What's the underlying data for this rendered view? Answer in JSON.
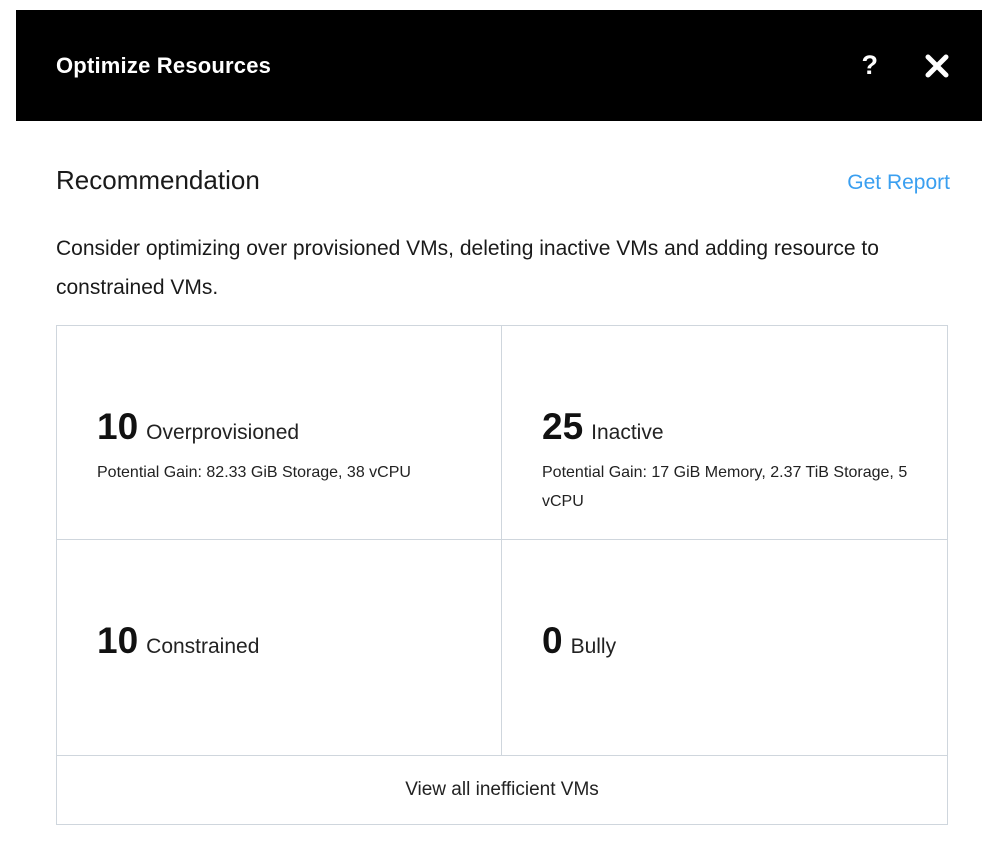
{
  "header": {
    "title": "Optimize Resources",
    "help_glyph": "?",
    "icons": {
      "help": "question-mark-icon",
      "close": "close-icon"
    }
  },
  "recommendation": {
    "title": "Recommendation",
    "report_link": "Get Report",
    "description": "Consider optimizing over provisioned VMs, deleting inactive VMs and adding resource to constrained VMs."
  },
  "stats": [
    {
      "count": "10",
      "label": "Overprovisioned",
      "gain": "Potential Gain: 82.33 GiB Storage, 38 vCPU"
    },
    {
      "count": "25",
      "label": "Inactive",
      "gain": "Potential Gain: 17 GiB Memory, 2.37 TiB Storage, 5 vCPU"
    },
    {
      "count": "10",
      "label": "Constrained",
      "gain": ""
    },
    {
      "count": "0",
      "label": "Bully",
      "gain": ""
    }
  ],
  "footer": {
    "view_all": "View all inefficient VMs"
  },
  "colors": {
    "header_bg": "#000000",
    "link": "#3a9ff0",
    "border": "#cfd6dd"
  }
}
